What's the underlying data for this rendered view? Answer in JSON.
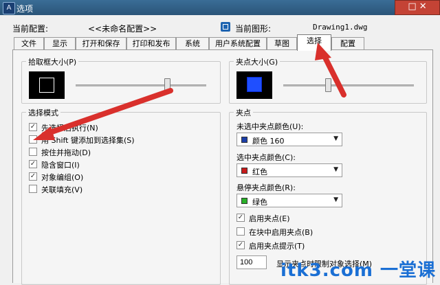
{
  "window": {
    "title": "选项",
    "app_icon": "A",
    "controls": "□ ✕"
  },
  "info": {
    "current_profile_label": "当前配置:",
    "current_profile_value": "<<未命名配置>>",
    "current_drawing_label": "当前图形:",
    "current_drawing_value": "Drawing1.dwg"
  },
  "tabs": [
    {
      "label": "文件"
    },
    {
      "label": "显示"
    },
    {
      "label": "打开和保存"
    },
    {
      "label": "打印和发布"
    },
    {
      "label": "系统"
    },
    {
      "label": "用户系统配置"
    },
    {
      "label": "草图"
    },
    {
      "label": "选择",
      "active": true
    },
    {
      "label": "配置"
    }
  ],
  "pickbox": {
    "title": "拾取框大小(P)",
    "slider_value": 0.7
  },
  "grip_size": {
    "title": "夹点大小(G)",
    "slider_value": 0.34,
    "preview_color": "#1f4fff"
  },
  "selection_modes": {
    "title": "选择模式",
    "options": [
      {
        "label": "先选择后执行(N)",
        "checked": true
      },
      {
        "label": "用 Shift 键添加到选择集(S)",
        "checked": false
      },
      {
        "label": "按住并拖动(D)",
        "checked": false
      },
      {
        "label": "隐含窗口(I)",
        "checked": true
      },
      {
        "label": "对象编组(O)",
        "checked": true
      },
      {
        "label": "关联填充(V)",
        "checked": false
      }
    ]
  },
  "grips": {
    "title": "夹点",
    "unselected_color_label": "未选中夹点颜色(U):",
    "unselected_color_value": "颜色 160",
    "unselected_color_hex": "#1c3fa8",
    "selected_color_label": "选中夹点颜色(C):",
    "selected_color_value": "红色",
    "selected_color_hex": "#c81c1c",
    "hover_color_label": "悬停夹点颜色(R):",
    "hover_color_value": "绿色",
    "hover_color_hex": "#28b028",
    "options": [
      {
        "label": "启用夹点(E)",
        "checked": true
      },
      {
        "label": "在块中启用夹点(B)",
        "checked": false
      },
      {
        "label": "启用夹点提示(T)",
        "checked": true
      }
    ],
    "object_limit_value": "100",
    "object_limit_label": "显示夹点时限制对象选择(M)"
  },
  "watermark": "itk3.com 一堂课",
  "colors": {
    "annotation_arrow": "#d9302c",
    "watermark": "#1a6fd4"
  }
}
